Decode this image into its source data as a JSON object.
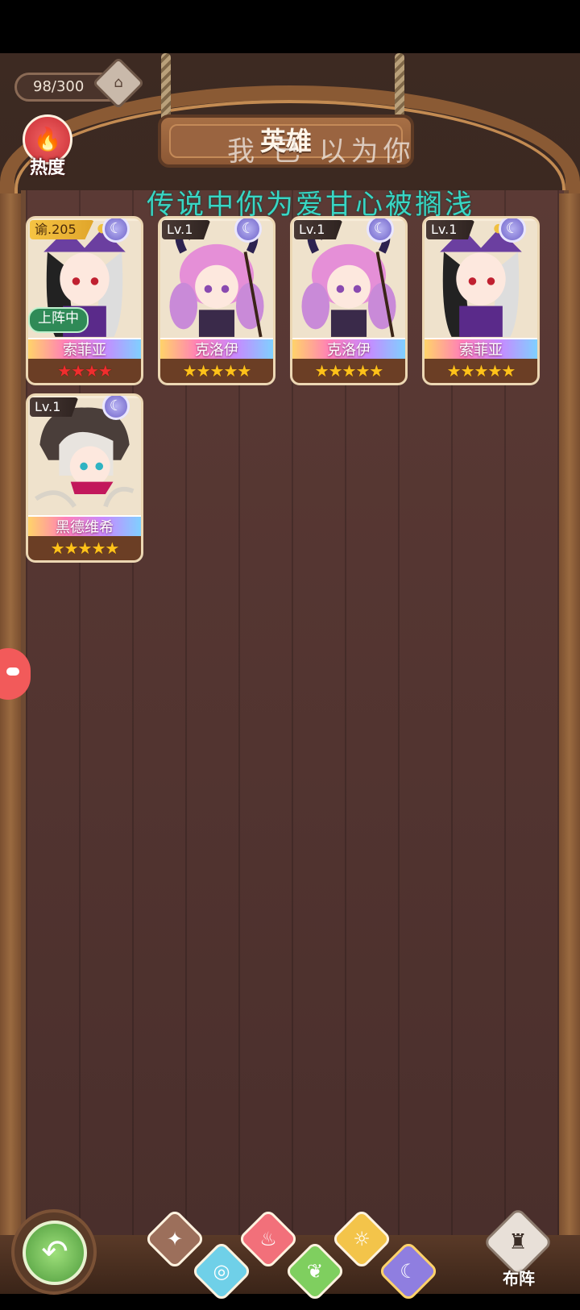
{
  "header": {
    "counter": "98/300",
    "heat_label": "热度",
    "title": "英雄"
  },
  "overlay_text": {
    "line1": "我 已 以为你",
    "line2": "传说中你为爱甘心被搁浅"
  },
  "cards": [
    {
      "tag": "谕.205",
      "name": "索菲亚",
      "stars": "★★★★",
      "star_color": "red",
      "deployed": "上阵中",
      "element": "moon"
    },
    {
      "tag": "Lv.1",
      "name": "克洛伊",
      "stars": "★★★★★",
      "star_color": "gold",
      "element": "moon"
    },
    {
      "tag": "Lv.1",
      "name": "克洛伊",
      "stars": "★★★★★",
      "star_color": "gold",
      "element": "moon"
    },
    {
      "tag": "Lv.1",
      "name": "索菲亚",
      "stars": "★★★★★",
      "star_color": "gold",
      "element": "moon"
    },
    {
      "tag": "Lv.1",
      "name": "黑德维希",
      "stars": "★★★★★",
      "star_color": "gold",
      "element": "moon"
    }
  ],
  "bottom_nav": {
    "filters": [
      {
        "name": "all",
        "icon": "all-elements-icon",
        "color": "#9c6f5b"
      },
      {
        "name": "water",
        "icon": "water-icon",
        "color": "#6fd0e8"
      },
      {
        "name": "fire",
        "icon": "fire-icon",
        "color": "#f2707a"
      },
      {
        "name": "wood",
        "icon": "leaf-icon",
        "color": "#7fcf5f"
      },
      {
        "name": "light",
        "icon": "sun-icon",
        "color": "#f3c44a"
      },
      {
        "name": "dark",
        "icon": "moon-icon",
        "color": "#8f7ee0"
      }
    ],
    "formation_label": "布阵"
  }
}
